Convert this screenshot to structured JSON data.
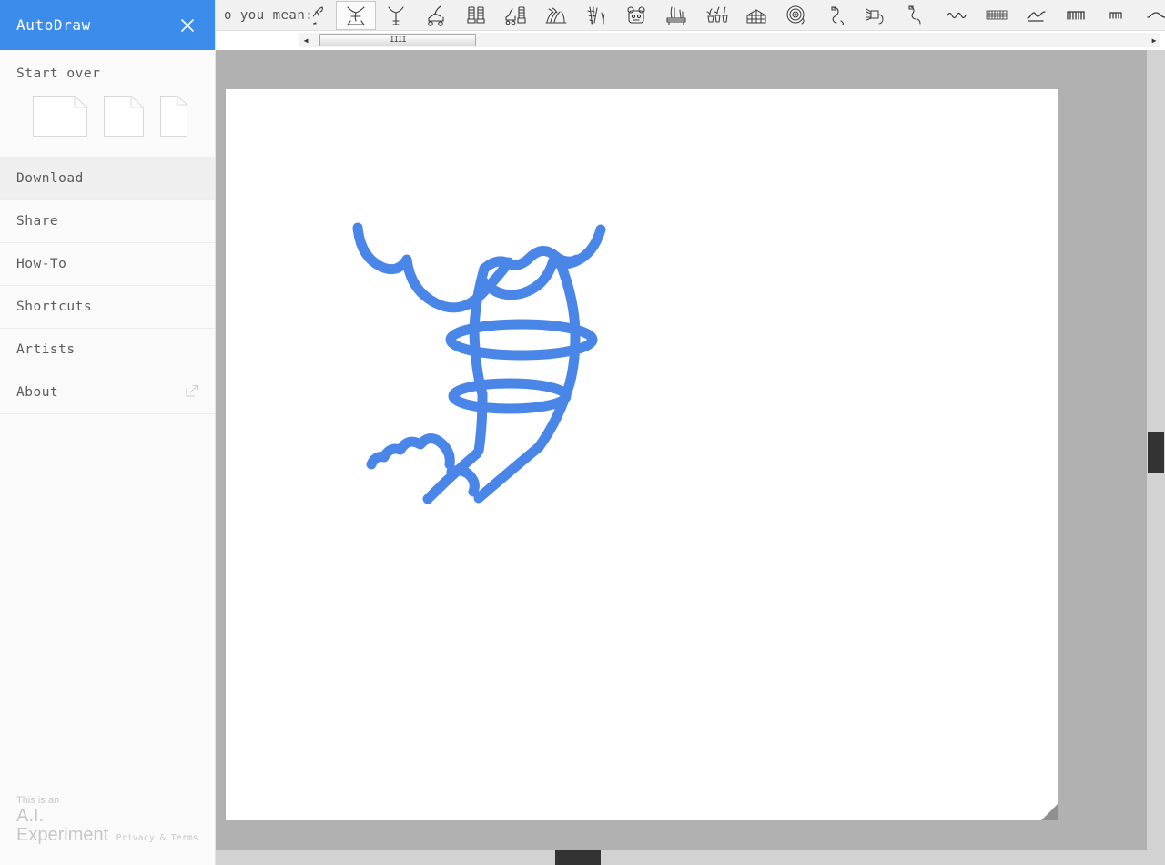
{
  "panel": {
    "title": "AutoDraw",
    "close_icon": "close-icon",
    "start_over": {
      "label": "Start over",
      "options": [
        {
          "name": "landscape",
          "icon": "page-landscape-icon"
        },
        {
          "name": "square",
          "icon": "page-square-icon"
        },
        {
          "name": "portrait",
          "icon": "page-portrait-icon"
        }
      ]
    },
    "menu": [
      {
        "label": "Download",
        "active": true,
        "external": false
      },
      {
        "label": "Share",
        "active": false,
        "external": false
      },
      {
        "label": "How-To",
        "active": false,
        "external": false
      },
      {
        "label": "Shortcuts",
        "active": false,
        "external": false
      },
      {
        "label": "Artists",
        "active": false,
        "external": false
      },
      {
        "label": "About",
        "active": false,
        "external": true,
        "external_icon": "external-link-icon"
      }
    ],
    "footer": {
      "line1": "This is an",
      "line2": "A.I.",
      "line3": "Experiment",
      "privacy": "Privacy & Terms"
    }
  },
  "suggestions": {
    "prompt": "o you mean:",
    "selected_index": 1,
    "items": [
      {
        "name": "ice-skate-icon"
      },
      {
        "name": "ice-skates-crossed-icon"
      },
      {
        "name": "figure-skater-icon"
      },
      {
        "name": "roller-skate-icon"
      },
      {
        "name": "ski-boots-icon"
      },
      {
        "name": "roller-skates-pair-icon"
      },
      {
        "name": "bicycle-rack-icon"
      },
      {
        "name": "bamboo-plant-icon"
      },
      {
        "name": "robot-face-icon"
      },
      {
        "name": "garden-bench-icon"
      },
      {
        "name": "potted-plants-icon"
      },
      {
        "name": "greenhouse-icon"
      },
      {
        "name": "hose-reel-icon"
      },
      {
        "name": "garden-hose-icon"
      },
      {
        "name": "sprinkler-icon"
      },
      {
        "name": "watering-wand-icon"
      },
      {
        "name": "squiggle-wave-icon"
      },
      {
        "name": "mesh-grid-icon"
      },
      {
        "name": "ocean-wave-icon"
      },
      {
        "name": "coil-spring-icon"
      },
      {
        "name": "small-coil-icon"
      },
      {
        "name": "simple-wave-icon"
      },
      {
        "name": "rose-flower-icon"
      }
    ],
    "scrollbar": {
      "left_arrow": "◀",
      "right_arrow": "▶",
      "grip": "IIII"
    }
  },
  "canvas": {
    "stroke_color": "#4a86e8",
    "background": "#ffffff",
    "workspace_background": "#b1b1b1"
  },
  "colors": {
    "brand_blue": "#3b8ceb",
    "stroke_blue": "#4a86e8",
    "panel_bg": "#fafafa",
    "menu_active": "#efefef",
    "workspace": "#b1b1b1",
    "scrollbar_thumb": "#333333"
  }
}
